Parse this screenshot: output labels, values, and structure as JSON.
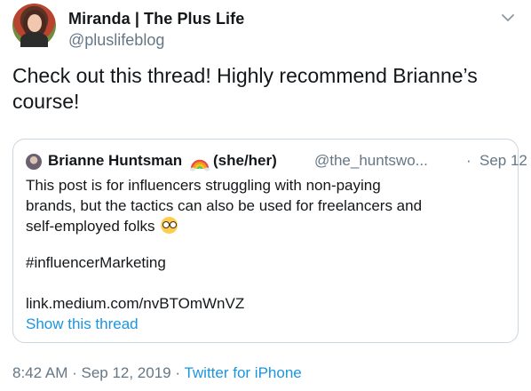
{
  "author": {
    "display_name": "Miranda | The Plus Life",
    "handle": "@pluslifeblog"
  },
  "tweet": {
    "text": "Check out this thread! Highly recommend Brianne’s course!"
  },
  "quoted_tweet": {
    "display_name": "Brianne Huntsman",
    "name_emoji": "rainbow-emoji",
    "pronouns": "(she/her)",
    "handle": "@the_huntswo...",
    "separator": "·",
    "date": "Sep 12",
    "lines": [
      "This post is for influencers struggling with non-paying",
      "brands, but the tactics can also be used for freelancers and",
      "self-employed folks"
    ],
    "line_emoji": "nerd-face-emoji",
    "hashtag": "#influencerMarketing",
    "link": "link.medium.com/nvBTOmWnVZ",
    "show_thread": "Show this thread"
  },
  "meta": {
    "time": "8:42 AM",
    "separator1": " · ",
    "date": "Sep 12, 2019",
    "separator2": " · ",
    "source": "Twitter for iPhone"
  },
  "colors": {
    "link": "#1b95e0",
    "secondary": "#657786",
    "border": "#ccd6dd",
    "text": "#14171a"
  }
}
